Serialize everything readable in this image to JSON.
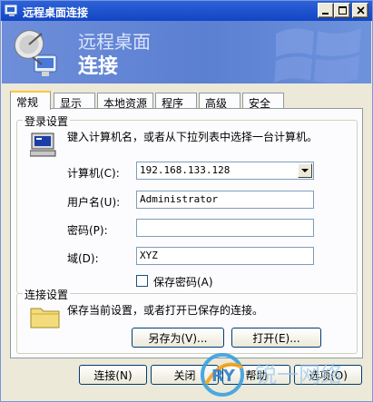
{
  "window": {
    "title": "远程桌面连接"
  },
  "banner": {
    "line1": "远程桌面",
    "line2": "连接"
  },
  "tabs": [
    {
      "label": "常规",
      "active": true
    },
    {
      "label": "显示"
    },
    {
      "label": "本地资源"
    },
    {
      "label": "程序"
    },
    {
      "label": "高级"
    },
    {
      "label": "安全"
    }
  ],
  "login": {
    "legend": "登录设置",
    "instruction": "键入计算机名，或者从下拉列表中选择一台计算机。",
    "computer_label": "计算机(C):",
    "computer_value": "192.168.133.128",
    "username_label": "用户名(U):",
    "username_value": "Administrator",
    "password_label": "密码(P):",
    "password_value": "",
    "domain_label": "域(D):",
    "domain_value": "XYZ",
    "save_password_label": "保存密码(A)",
    "save_password_checked": false
  },
  "connection": {
    "legend": "连接设置",
    "text": "保存当前设置，或者打开已保存的连接。",
    "save_as": "另存为(V)...",
    "open": "打开(E)..."
  },
  "buttons": {
    "connect": "连接(N)",
    "close": "关闭",
    "help": "帮助",
    "options": "选项(O)"
  },
  "watermark": {
    "text": "RY 锐一网络"
  },
  "colors": {
    "titlebar": "#1245c4",
    "banner": "#5b7fd2",
    "face": "#ece9d8",
    "tab_highlight": "#ffc73c"
  }
}
